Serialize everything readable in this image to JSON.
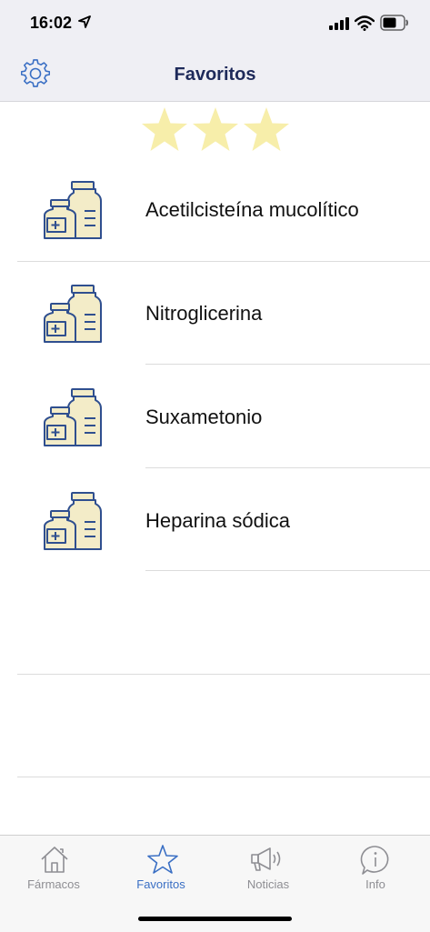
{
  "status_bar": {
    "time": "16:02"
  },
  "nav": {
    "title": "Favoritos"
  },
  "favorites": [
    {
      "name": "Acetilcisteína mucolítico"
    },
    {
      "name": "Nitroglicerina"
    },
    {
      "name": "Suxametonio"
    },
    {
      "name": "Heparina sódica"
    }
  ],
  "tabs": [
    {
      "label": "Fármacos",
      "icon": "home-icon",
      "active": false
    },
    {
      "label": "Favoritos",
      "icon": "star-icon",
      "active": true
    },
    {
      "label": "Noticias",
      "icon": "megaphone-icon",
      "active": false
    },
    {
      "label": "Info",
      "icon": "info-icon",
      "active": false
    }
  ],
  "colors": {
    "accent": "#3a6fc4",
    "title": "#1e2a5a",
    "inactive": "#8e8e93",
    "star": "#f7eeaa",
    "pill_fill": "#f3ecc8",
    "pill_stroke": "#2f4f8f"
  }
}
